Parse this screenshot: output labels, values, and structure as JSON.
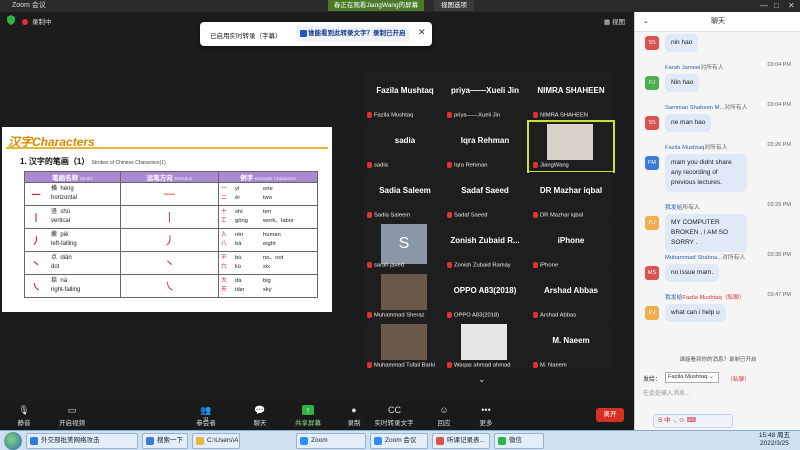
{
  "titlebar": {
    "title": "Zoom 会议",
    "center_label": "春正在观看JiangWang的屏幕",
    "view_options": "视图选项"
  },
  "recording": {
    "label": "录制中"
  },
  "toast": {
    "text_a": "已启用实时转录（字幕）",
    "text_b": "谁能看到此转录文字？录制已开启"
  },
  "view_button": "视图",
  "slide": {
    "heading": "汉字Characters",
    "subtitle_cn": "1. 汉字的笔画（1）",
    "subtitle_en": "Strokes of Chinese Characters(1)",
    "headers": [
      {
        "cn": "笔画名称",
        "en": "Stroke"
      },
      {
        "cn": "运笔方向",
        "en": "Direction"
      },
      {
        "cn": "例字",
        "en": "Example Characters"
      }
    ],
    "rows": [
      {
        "stroke": "一",
        "cn": "横",
        "pinyin": "héng",
        "en": "horizontal",
        "dir": "—",
        "examples": [
          {
            "ch": "一",
            "py": "yī",
            "en": "one"
          },
          {
            "ch": "二",
            "py": "èr",
            "en": "two"
          }
        ]
      },
      {
        "stroke": "丨",
        "cn": "竖",
        "pinyin": "shù",
        "en": "vertical",
        "dir": "|",
        "examples": [
          {
            "ch": "十",
            "py": "shí",
            "en": "ten"
          },
          {
            "ch": "工",
            "py": "gōng",
            "en": "work、labor"
          }
        ]
      },
      {
        "stroke": "丿",
        "cn": "撇",
        "pinyin": "piě",
        "en": "left-falling",
        "dir": "丿",
        "examples": [
          {
            "ch": "人",
            "py": "rén",
            "en": "human"
          },
          {
            "ch": "八",
            "py": "bā",
            "en": "eight"
          }
        ]
      },
      {
        "stroke": "丶",
        "cn": "点",
        "pinyin": "diǎn",
        "en": "dot",
        "dir": "丶",
        "examples": [
          {
            "ch": "不",
            "py": "bù",
            "en": "no、not"
          },
          {
            "ch": "六",
            "py": "liù",
            "en": "six"
          }
        ]
      },
      {
        "stroke": "㇏",
        "cn": "捺",
        "pinyin": "nà",
        "en": "right-falling",
        "dir": "㇏",
        "examples": [
          {
            "ch": "大",
            "py": "dà",
            "en": "big"
          },
          {
            "ch": "天",
            "py": "tiān",
            "en": "sky"
          }
        ]
      }
    ]
  },
  "participants": [
    {
      "display": "Fazila Mushtaq",
      "name": "Fazila Mushtaq"
    },
    {
      "display": "priya——Xueli Jin",
      "name": "priya——Xueli Jin"
    },
    {
      "display": "NIMRA SHAHEEN",
      "name": "NIMRA SHAHEEN"
    },
    {
      "display": "sadia",
      "name": "sadia"
    },
    {
      "display": "Iqra Rehman",
      "name": "Iqra Rehman"
    },
    {
      "display": "",
      "name": "JiangWang"
    },
    {
      "display": "Sadia Saleem",
      "name": "Sadia Saleem"
    },
    {
      "display": "Sadaf Saeed",
      "name": "Sadaf Saeed"
    },
    {
      "display": "DR Mazhar iqbal",
      "name": "DR Mazhar iqbal"
    },
    {
      "display": "S",
      "name": "sarah javed"
    },
    {
      "display": "Zonish Zubaid R...",
      "name": "Zonish Zubaid Ramay"
    },
    {
      "display": "iPhone",
      "name": "iPhone"
    },
    {
      "display": "",
      "name": "Muhammad Sheraz"
    },
    {
      "display": "OPPO A83(2018)",
      "name": "OPPO A83(2018)"
    },
    {
      "display": "Arshad Abbas",
      "name": "Arshad Abbas"
    },
    {
      "display": "",
      "name": "Muhammad Tufail Barki"
    },
    {
      "display": "",
      "name": "Waqas ahmad ahmad"
    },
    {
      "display": "M. Naeem",
      "name": "M. Naeem"
    }
  ],
  "toolbar": {
    "mute": "静音",
    "video": "开启视频",
    "participants": "参会者",
    "participants_count": "31",
    "chat": "聊天",
    "share": "共享屏幕",
    "record": "录制",
    "transcript": "实时转录文字",
    "reactions": "回应",
    "more": "更多",
    "leave": "离开"
  },
  "chat": {
    "title": "聊天",
    "messages": [
      {
        "initials": "SS",
        "color": "#d9534f",
        "who": "",
        "to": "",
        "time": "",
        "text": "nin hao"
      },
      {
        "initials": "FJ",
        "color": "#4cae4c",
        "who": "Farah Jameel",
        "to": "对所有人",
        "time": "03:04 PM",
        "text": "Nin hao"
      },
      {
        "initials": "SS",
        "color": "#d9534f",
        "who": "Samman Shaheen M...",
        "to": "对所有人",
        "time": "03:04 PM",
        "text": "ne man hao"
      },
      {
        "initials": "FM",
        "color": "#3b7bd5",
        "who": "Fazila Mushtaq",
        "to": "对所有人",
        "time": "03:26 PM",
        "text": "mam you didnt share any recording of previous lectures."
      },
      {
        "initials": "PJ",
        "color": "#f0ad4e",
        "who": "我发给",
        "to": "所有人",
        "time": "03:29 PM",
        "text": "MY COMPUTER BROKEN , I AM SO SORRY ."
      },
      {
        "initials": "MS",
        "color": "#d9534f",
        "who": "Muhammad Shahna...",
        "to": "对所有人",
        "time": "03:38 PM",
        "text": "no issue mam."
      },
      {
        "initials": "PJ",
        "color": "#f0ad4e",
        "who": "我发给",
        "to": "Fazila Mushtaq（私聊）",
        "time": "03:47 PM",
        "text": "what can i help u"
      }
    ],
    "note": "谁能看到你的消息？录制已开启",
    "send_to_label": "发给：",
    "send_to_value": "Fazila Mushtaq ⌄",
    "private": "（私聊）",
    "input_placeholder": "在此处输入消息..."
  },
  "taskbar": {
    "items": [
      "外交部批美网络攻击",
      "搜索一下",
      "C:\\Users\\A...",
      "Zoom",
      "Zoom 会议",
      "听课记录表...",
      "微信"
    ],
    "time": "15:48 周五",
    "date": "2022/3/25"
  }
}
